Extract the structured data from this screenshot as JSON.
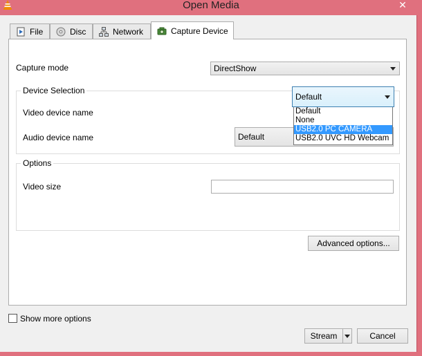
{
  "window": {
    "title": "Open Media"
  },
  "tabs": [
    {
      "label": "File",
      "icon": "file-icon"
    },
    {
      "label": "Disc",
      "icon": "disc-icon"
    },
    {
      "label": "Network",
      "icon": "network-icon"
    },
    {
      "label": "Capture Device",
      "icon": "capture-device-icon",
      "active": true
    }
  ],
  "capture": {
    "mode_label": "Capture mode",
    "mode_value": "DirectShow"
  },
  "device_selection": {
    "title": "Device Selection",
    "video_label": "Video device name",
    "video_value": "Default",
    "audio_label": "Audio device name",
    "audio_value": "Default",
    "video_options": [
      "Default",
      "None",
      "USB2.0 PC CAMERA",
      "USB2.0 UVC HD Webcam"
    ],
    "highlighted_option": "USB2.0 PC CAMERA"
  },
  "options": {
    "title": "Options",
    "video_size_label": "Video size",
    "video_size_value": ""
  },
  "buttons": {
    "advanced": "Advanced options...",
    "stream": "Stream",
    "cancel": "Cancel"
  },
  "show_more": {
    "label": "Show more options",
    "checked": false
  },
  "colors": {
    "titlebar": "#e0707e",
    "highlight": "#3399ff"
  }
}
